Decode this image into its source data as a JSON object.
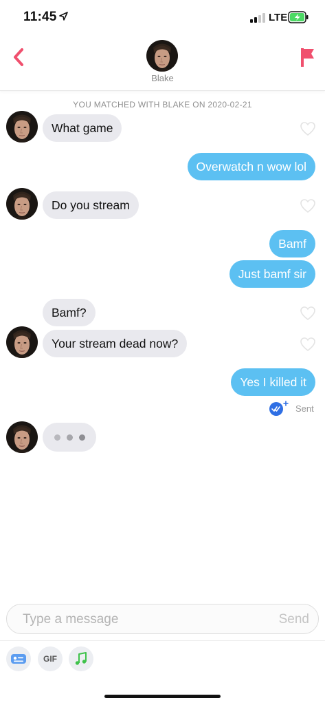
{
  "status_bar": {
    "time": "11:45",
    "network": "LTE",
    "battery_color": "#4cd964"
  },
  "header": {
    "name": "Blake",
    "accent": "#f0506e"
  },
  "match_line": "YOU MATCHED WITH BLAKE ON 2020-02-21",
  "messages": [
    {
      "from": "them",
      "text": "What game"
    },
    {
      "from": "me",
      "text": "Overwatch n wow lol"
    },
    {
      "from": "them",
      "text": "Do you stream"
    },
    {
      "from": "me",
      "text": "Bamf"
    },
    {
      "from": "me",
      "text": "Just bamf sir"
    },
    {
      "from": "them",
      "text": "Bamf?"
    },
    {
      "from": "them",
      "text": "Your stream dead now?"
    },
    {
      "from": "me",
      "text": "Yes I killed it"
    }
  ],
  "receipt": {
    "label": "Sent",
    "color": "#2f6fe4"
  },
  "colors": {
    "outgoing_bubble": "#5cc0f2",
    "incoming_bubble": "#e9e9ee"
  },
  "composer": {
    "placeholder": "Type a message",
    "send_label": "Send"
  },
  "toolbar": {
    "gif_label": "GIF"
  }
}
